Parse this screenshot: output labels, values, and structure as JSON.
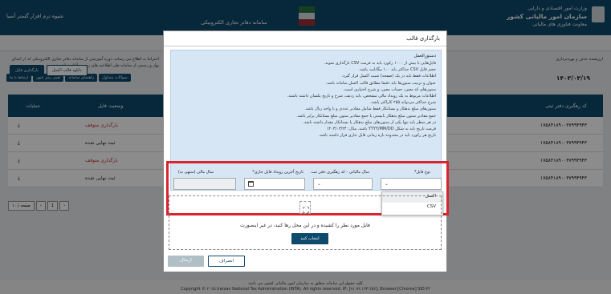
{
  "background": {
    "user_label": "شیوه ترم افزار گستر آسیا",
    "org_title": "سازمان امور مالیاتی کشور",
    "org_subtitle": "معاونت فناوری های مالیاتی",
    "ministry": "وزارت امور اقتصادی و دارایی",
    "system_title": "سامانه دفاتر تجاری الکترونیکی",
    "date": "۱۴۰۳/۰۳/۱۹",
    "nav_buttons": [
      "ارتباط با ما",
      "تغییر رمز عبور",
      "راهنمای سامانه",
      "سوالات متداول"
    ],
    "notice_left": "احتراما به اطلاع می رساند، دوره آموزشی از سامانه دفاتر تجاری الکترونیکی که از ابتدای بهار و رسمی از سامانه طی اطلاعیه های رسمی آغاز خواهد شد.",
    "notice_right": "ارزیشده حذف و بهره‌برداری",
    "action_buttons": {
      "download_excel": "دانلود قالب اکسل",
      "upload_file": "بارگذاری فایل"
    },
    "table": {
      "headers": [
        "عملیات",
        "وضعیت فایل",
        "کد رهگیری دفتر ثبتی"
      ],
      "rows": [
        {
          "code": "۱۷۵۸۴۱۸۹۰۰۳۷۹۹۴۹۴۳",
          "status": "بارگذاری متوقف",
          "status_color": "#c62828"
        },
        {
          "code": "۱۷۵۸۴۱۸۹۰۰۳۷۹۹۴۹۴۳",
          "status": "ثبت نهایی شده",
          "status_color": "#222222"
        },
        {
          "code": "۱۷۵۸۴۱۸۹۰۰۳۷۹۹۴۹۴۳",
          "status": "بارگذاری متوقف",
          "status_color": "#c62828"
        },
        {
          "code": "۱۷۵۸۴۱۸۹۰۰۳۷۹۹۴۹۴۳",
          "status": "ثبت نهایی شده",
          "status_color": "#222222"
        }
      ]
    },
    "pager": {
      "per_page": "۱۰ / صفحه",
      "current": "1"
    },
    "footer": {
      "line1": "کلیه حقوق این سامانه متعلق به سازمان امور مالیاتی کشور می باشد",
      "line2": "Copyright © ۲۰۲۵ Iranian National Tax Administration (INTA). All rights reserved. IP: [۹۱.۹۲.۱۳۳.۲۵۶], Browser:[Chrome] SID:۳۴"
    }
  },
  "modal": {
    "title": "بارگذاری قالب",
    "instructions_title": "دستورالعمل",
    "instructions": [
      "فایل‌هایی با بیش از ۱۰۰۰ رکورد باید به فرمت CSV بارگذاری شوند.",
      "حجم فایل CSV حداکثر باید ۱۰۰ مگابایت باشد.",
      "اطلاعات فقط باید در یک (صفحه) شیت اکسل قرار گیرد.",
      "عنوان و ترتیب ستون‌ها باید دقیقا مطابق قالب اکسل سامانه باشد.",
      "ستون‌های کد معین، حساب معین، و شرح اختیاری است.",
      "اطلاعات مربوط به یک رویداد مالی مشخص، باید ردیف، شرح و تاریخ یکسان داشته باشند.",
      "شرح حداکثر می‌تواند ۲۵۵ کاراکتر باشد.",
      "ستون‌های مبلغ بدهکار و بستانکار فقط شامل مقادیر عددی و با واحد ریال باشد.",
      "جمع مقادیر ستون مبلغ بدهکار بایستی با جمع مقادیر ستون مبلغ بستانکار برابر باشد.",
      "در هر سطر باید تنها یکی از ستون‌های مبلغ بدهکار یا بستانکار مقدار داشته باشد.",
      "فرمت تاریخ باید به شکل YYYY/MM/DD باشد. مثال: ۱۴۰۳/۰۳/۲۴",
      "تاریخ هر رکورد باید در محدوده بازه زمانی فایل جاری قرار داشته باشد."
    ],
    "fields": {
      "file_type_label": "نوع فایل*",
      "file_type_placeholder": "",
      "fiscal_year_label": "سال مالیاتی - کد رهگیری دفتر ثبت",
      "last_event_date_label": "تاریخ آخرین رویداد فایل جاری*",
      "fiscal_year_end_label": "سال مالی (منتهی به)"
    },
    "file_type_options": [
      "اکسل",
      "CSV"
    ],
    "dropzone": {
      "text": "فایل مورد نظر را کشیده و در این محل رها کنید، در غیر اینصورت",
      "choose_button": "انتخاب کنید"
    },
    "buttons": {
      "send": "ارسال",
      "cancel": "انصراف"
    }
  },
  "colors": {
    "header_blue": "#0d4a6b",
    "highlight_red": "#d8262f",
    "instructions_bg": "#d6e6f5"
  }
}
